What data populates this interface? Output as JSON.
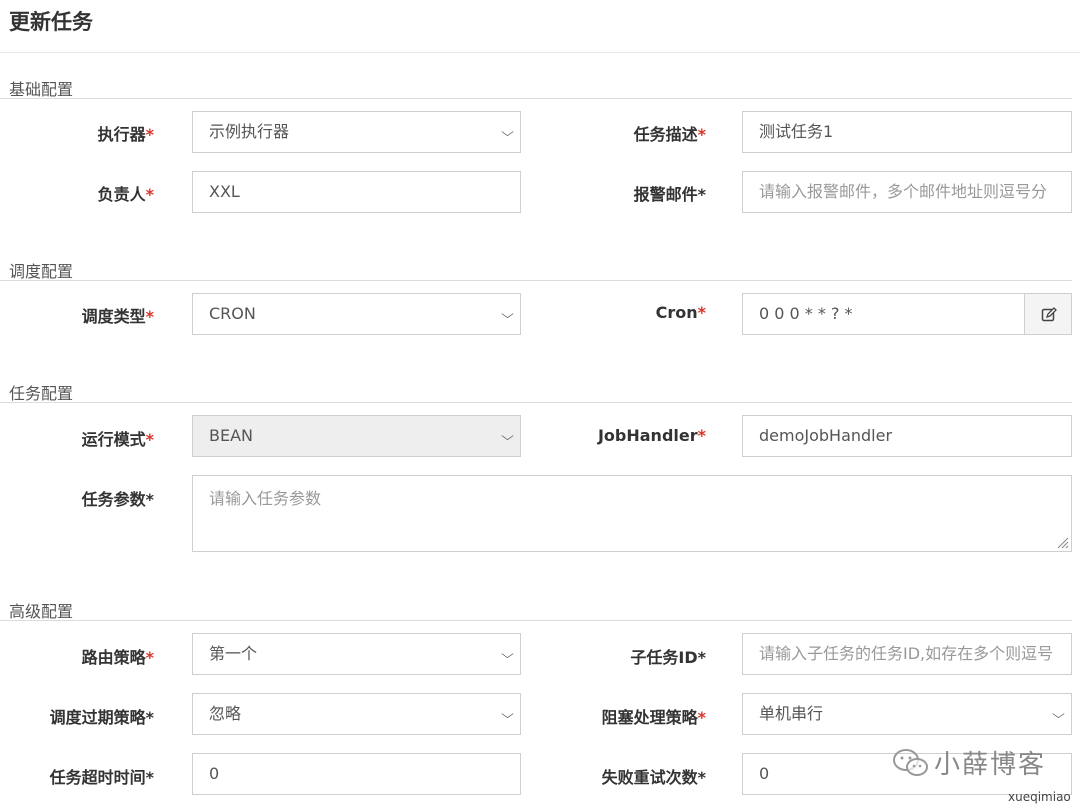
{
  "header": {
    "title": "更新任务"
  },
  "sections": {
    "basic": "基础配置",
    "schedule": "调度配置",
    "task": "任务配置",
    "advanced": "高级配置"
  },
  "fields": {
    "executor": {
      "label": "执行器",
      "value": "示例执行器"
    },
    "task_desc": {
      "label": "任务描述",
      "value": "测试任务1"
    },
    "owner": {
      "label": "负责人",
      "value": "XXL"
    },
    "alarm_email": {
      "label": "报警邮件",
      "placeholder": "请输入报警邮件，多个邮件地址则逗号分"
    },
    "schedule_type": {
      "label": "调度类型",
      "value": "CRON"
    },
    "cron": {
      "label": "Cron",
      "value": "0 0 0 * * ? *"
    },
    "run_mode": {
      "label": "运行模式",
      "value": "BEAN"
    },
    "job_handler": {
      "label": "JobHandler",
      "value": "demoJobHandler"
    },
    "task_params": {
      "label": "任务参数",
      "placeholder": "请输入任务参数"
    },
    "route_strategy": {
      "label": "路由策略",
      "value": "第一个"
    },
    "child_task_id": {
      "label": "子任务ID",
      "placeholder": "请输入子任务的任务ID,如存在多个则逗号"
    },
    "misfire_strategy": {
      "label": "调度过期策略",
      "value": "忽略"
    },
    "block_strategy": {
      "label": "阻塞处理策略",
      "value": "单机串行"
    },
    "timeout": {
      "label": "任务超时时间",
      "value": "0"
    },
    "retry_count": {
      "label": "失败重试次数",
      "value": "0"
    }
  },
  "required_mark": "*",
  "watermark": {
    "text": "小薛博客",
    "sub": "xueqimiao"
  },
  "colors": {
    "required": "#d9352b",
    "border": "#cfcfcf",
    "disabled_bg": "#eeeeee"
  }
}
